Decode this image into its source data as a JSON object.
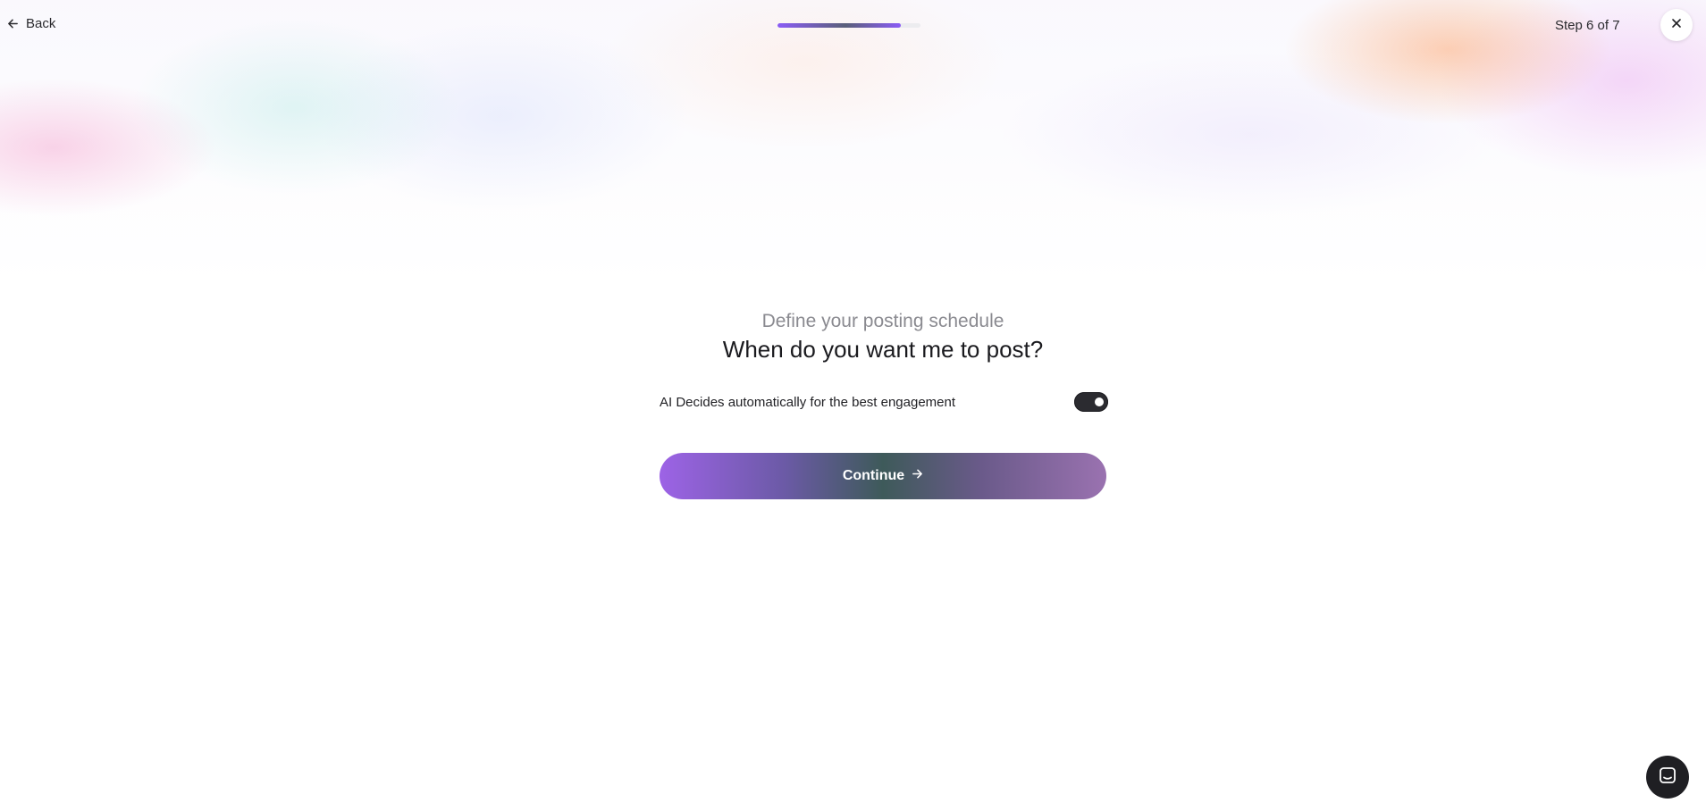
{
  "header": {
    "back_label": "Back",
    "step_label": "Step 6 of 7",
    "progress_fraction": 0.86
  },
  "main": {
    "subtitle": "Define your posting schedule",
    "title": "When do you want me to post?",
    "ai_toggle": {
      "label": "AI Decides automatically for the best engagement",
      "checked": true
    },
    "continue_label": "Continue"
  },
  "icons": {
    "back": "arrow-left-icon",
    "close": "close-icon",
    "continue": "arrow-right-icon",
    "chat": "chat-icon"
  },
  "colors": {
    "accent": "#8b5cf6",
    "toggle_on": "#2b2b30",
    "chat_button": "#1f1f23"
  }
}
